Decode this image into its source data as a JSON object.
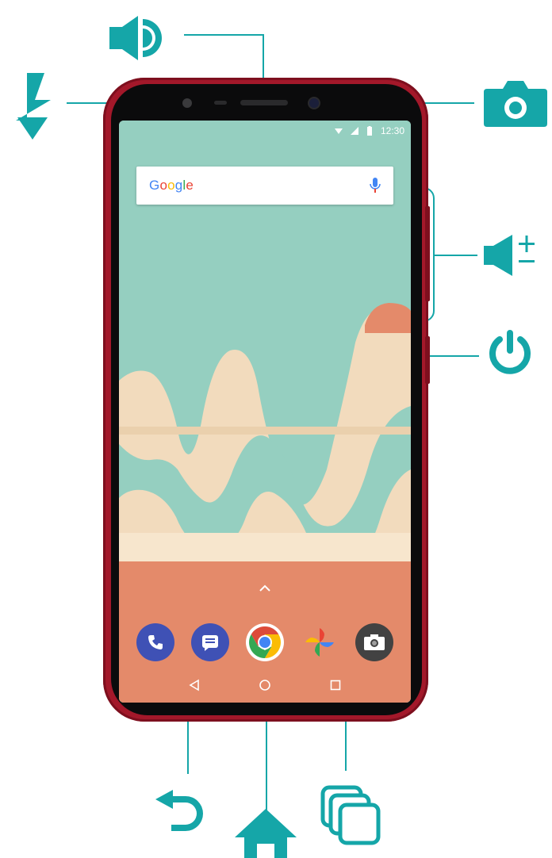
{
  "statusbar": {
    "time": "12:30",
    "icons": [
      "wifi-icon",
      "signal-icon",
      "battery-icon"
    ]
  },
  "search": {
    "logo": "Google",
    "logo_colors": [
      "#4285f4",
      "#ea4335",
      "#fbbc05",
      "#4285f4",
      "#34a853",
      "#ea4335"
    ],
    "mic_icon": "mic-icon"
  },
  "dock": {
    "apps": [
      {
        "name": "phone-app-icon",
        "color": "#3f51b5"
      },
      {
        "name": "messages-app-icon",
        "color": "#3f51b5"
      },
      {
        "name": "chrome-app-icon",
        "color": "#dd4b39"
      },
      {
        "name": "photos-app-icon",
        "color": "#fbbc05"
      },
      {
        "name": "camera-app-icon",
        "color": "#424242"
      }
    ],
    "drawer_icon": "chevron-up-icon"
  },
  "navbar": {
    "buttons": [
      "back-icon",
      "home-icon",
      "recents-icon"
    ]
  },
  "callouts": {
    "top": [
      "earpiece-speaker-icon"
    ],
    "left": [
      "flash-icon"
    ],
    "right": [
      "front-camera-icon",
      "volume-buttons-icon",
      "power-button-icon"
    ],
    "bottom": [
      "back-arrow-icon",
      "home-house-icon",
      "recents-stack-icon"
    ]
  },
  "colors": {
    "accent": "#15a6a8",
    "phone_body": "#a3182a",
    "wallpaper_teal": "#95cfc0",
    "wallpaper_cream": "#f2dbbd",
    "wallpaper_coral": "#e48a6a"
  }
}
